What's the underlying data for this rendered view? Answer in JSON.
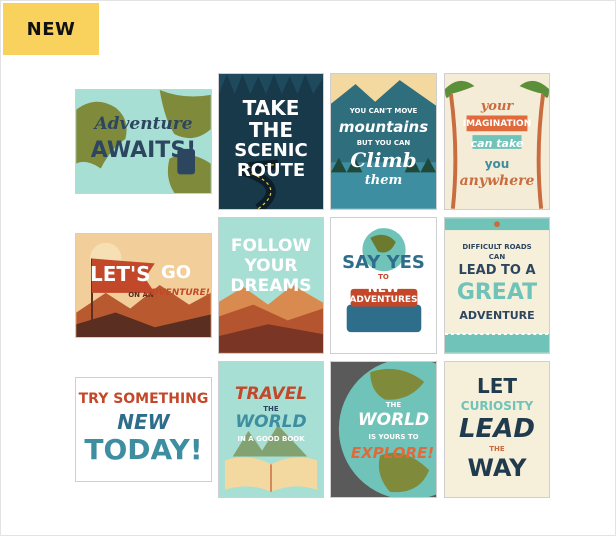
{
  "badge": {
    "label": "NEW"
  },
  "posters": [
    {
      "lines": [
        "Adventure",
        "AWAITS!"
      ]
    },
    {
      "lines": [
        "TAKE",
        "THE",
        "SCENIC",
        "ROUTE"
      ]
    },
    {
      "lines": [
        "YOU CAN'T MOVE",
        "mountains",
        "BUT YOU CAN",
        "Climb",
        "them"
      ]
    },
    {
      "lines": [
        "your",
        "IMAGINATION",
        "can take",
        "you",
        "anywhere"
      ]
    },
    {
      "lines": [
        "LET'S",
        "GO",
        "ON AN",
        "ADVENTURE!"
      ]
    },
    {
      "lines": [
        "FOLLOW",
        "YOUR",
        "DREAMS"
      ]
    },
    {
      "lines": [
        "SAY YES",
        "TO",
        "NEW",
        "ADVENTURES"
      ]
    },
    {
      "lines": [
        "DIFFICULT ROADS",
        "CAN",
        "LEAD TO A",
        "GREAT",
        "ADVENTURE"
      ]
    },
    {
      "lines": [
        "TRY SOMETHING",
        "NEW",
        "TODAY!"
      ]
    },
    {
      "lines": [
        "TRAVEL",
        "THE",
        "WORLD",
        "IN A GOOD BOOK"
      ]
    },
    {
      "lines": [
        "THE",
        "WORLD",
        "IS YOURS TO",
        "EXPLORE!"
      ]
    },
    {
      "lines": [
        "LET",
        "CURIOSITY",
        "LEAD",
        "THE",
        "WAY"
      ]
    }
  ],
  "colors": {
    "badge": "#f9d25e",
    "mint": "#a8dfd4",
    "navy": "#1f3b4d",
    "orange": "#e06a3b",
    "olive": "#6b7a2e"
  }
}
